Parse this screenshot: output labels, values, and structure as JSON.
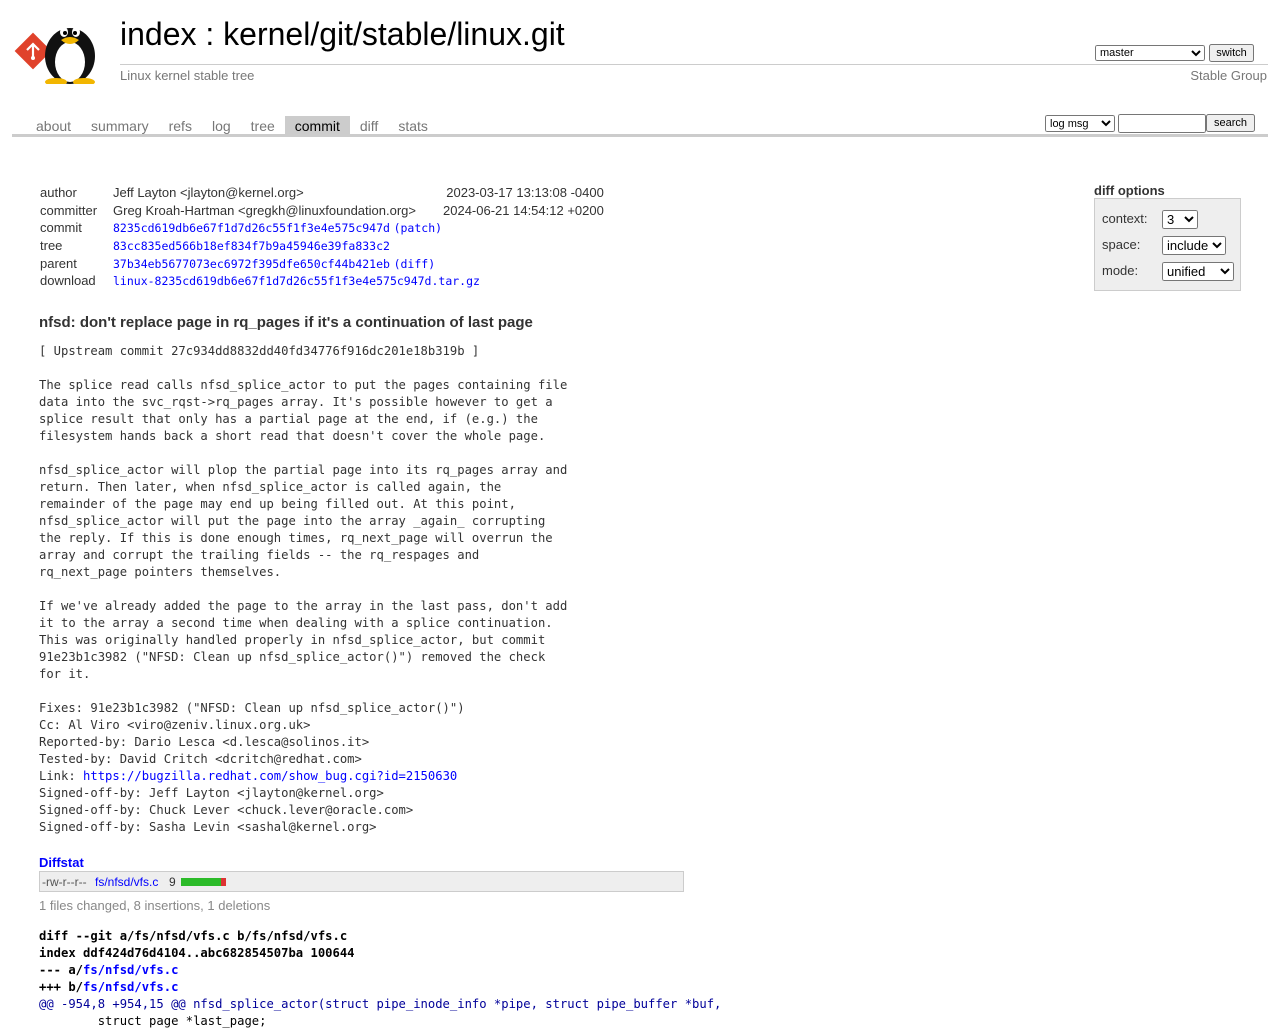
{
  "header": {
    "title_prefix": "index",
    "title_sep": " : ",
    "repo": "kernel/git/stable/linux.git",
    "description": "Linux kernel stable tree",
    "owner": "Stable Group",
    "branch_selected": "master",
    "switch_label": "switch"
  },
  "tabs": [
    {
      "label": "about",
      "active": false
    },
    {
      "label": "summary",
      "active": false
    },
    {
      "label": "refs",
      "active": false
    },
    {
      "label": "log",
      "active": false
    },
    {
      "label": "tree",
      "active": false
    },
    {
      "label": "commit",
      "active": true
    },
    {
      "label": "diff",
      "active": false
    },
    {
      "label": "stats",
      "active": false
    }
  ],
  "search": {
    "type_selected": "log msg",
    "query": "",
    "button_label": "search"
  },
  "commit_info": {
    "author": {
      "label": "author",
      "value": "Jeff Layton <jlayton@kernel.org>",
      "date": "2023-03-17 13:13:08 -0400"
    },
    "committer": {
      "label": "committer",
      "value": "Greg Kroah-Hartman <gregkh@linuxfoundation.org>",
      "date": "2024-06-21 14:54:12 +0200"
    },
    "commit": {
      "label": "commit",
      "sha": "8235cd619db6e67f1d7d26c55f1f3e4e575c947d",
      "link": "(patch)"
    },
    "tree": {
      "label": "tree",
      "sha": "83cc835ed566b18ef834f7b9a45946e39fa833c2"
    },
    "parent": {
      "label": "parent",
      "sha": "37b34eb5677073ec6972f395dfe650cf44b421eb",
      "link": "(diff)"
    },
    "download": {
      "label": "download",
      "file": "linux-8235cd619db6e67f1d7d26c55f1f3e4e575c947d.tar.gz"
    }
  },
  "diff_options": {
    "heading": "diff options",
    "context": {
      "label": "context:",
      "value": "3"
    },
    "space": {
      "label": "space:",
      "value": "include"
    },
    "mode": {
      "label": "mode:",
      "value": "unified"
    }
  },
  "message": {
    "subject": "nfsd: don't replace page in rq_pages if it's a continuation of last page",
    "body_before_link": "[ Upstream commit 27c934dd8832dd40fd34776f916dc201e18b319b ]\n\nThe splice read calls nfsd_splice_actor to put the pages containing file\ndata into the svc_rqst->rq_pages array. It's possible however to get a\nsplice result that only has a partial page at the end, if (e.g.) the\nfilesystem hands back a short read that doesn't cover the whole page.\n\nnfsd_splice_actor will plop the partial page into its rq_pages array and\nreturn. Then later, when nfsd_splice_actor is called again, the\nremainder of the page may end up being filled out. At this point,\nnfsd_splice_actor will put the page into the array _again_ corrupting\nthe reply. If this is done enough times, rq_next_page will overrun the\narray and corrupt the trailing fields -- the rq_respages and\nrq_next_page pointers themselves.\n\nIf we've already added the page to the array in the last pass, don't add\nit to the array a second time when dealing with a splice continuation.\nThis was originally handled properly in nfsd_splice_actor, but commit\n91e23b1c3982 (\"NFSD: Clean up nfsd_splice_actor()\") removed the check\nfor it.\n\nFixes: 91e23b1c3982 (\"NFSD: Clean up nfsd_splice_actor()\")\nCc: Al Viro <viro@zeniv.linux.org.uk>\nReported-by: Dario Lesca <d.lesca@solinos.it>\nTested-by: David Critch <dcritch@redhat.com>\nLink: ",
    "link": "https://bugzilla.redhat.com/show_bug.cgi?id=2150630",
    "body_after_link": "\nSigned-off-by: Jeff Layton <jlayton@kernel.org>\nSigned-off-by: Chuck Lever <chuck.lever@oracle.com>\nSigned-off-by: Sasha Levin <sashal@kernel.org>"
  },
  "diffstat": {
    "heading": "Diffstat",
    "mode": "-rw-r--r--",
    "file": "fs/nfsd/vfs.c",
    "count": "9",
    "insertions": 8,
    "deletions": 1,
    "summary": "1 files changed, 8 insertions, 1 deletions",
    "colors": {
      "insert": "#2cbb29",
      "delete": "#dd3333"
    }
  },
  "diff": {
    "git_line": "diff --git a/fs/nfsd/vfs.c b/fs/nfsd/vfs.c",
    "index_line": "index ddf424d76d4104..abc682854507ba 100644",
    "old_prefix": "--- a/",
    "new_prefix": "+++ b/",
    "file": "fs/nfsd/vfs.c",
    "hunk_header": "@@ -954,8 +954,15 @@",
    "hunk_context": " nfsd_splice_actor(struct pipe_inode_info *pipe, struct pipe_buffer *buf,",
    "first_line": "        struct page *last_page;"
  }
}
